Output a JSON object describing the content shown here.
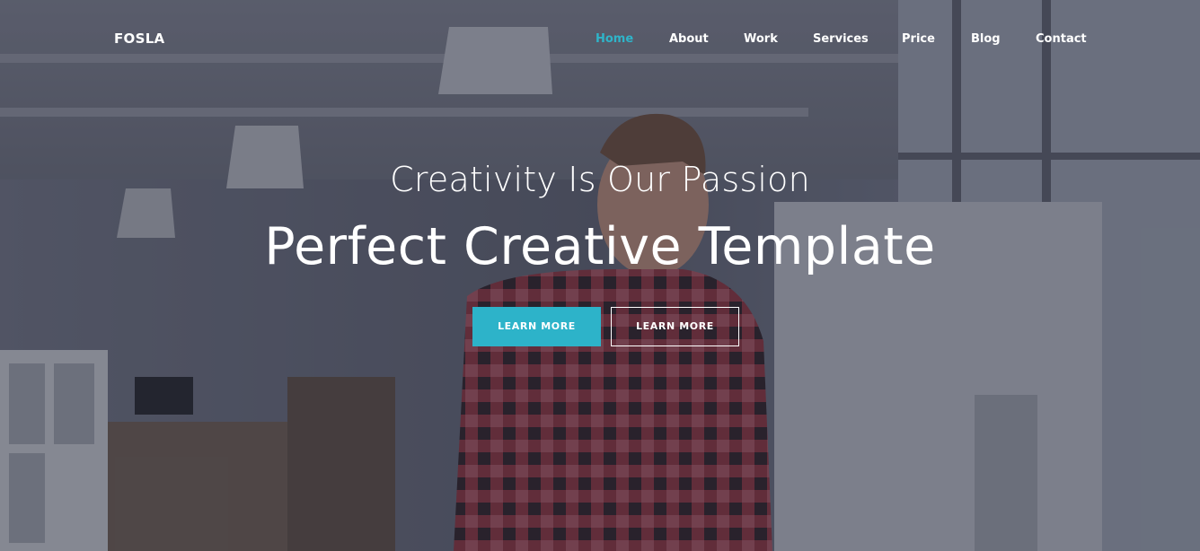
{
  "brand": "FOSLA",
  "nav": {
    "items": [
      {
        "label": "Home",
        "active": true
      },
      {
        "label": "About"
      },
      {
        "label": "Work"
      },
      {
        "label": "Services"
      },
      {
        "label": "Price"
      },
      {
        "label": "Blog"
      },
      {
        "label": "Contact"
      }
    ]
  },
  "hero": {
    "subtitle": "Creativity Is Our Passion",
    "title": "Perfect Creative Template",
    "primary_button": "LEARN MORE",
    "secondary_button": "LEARN MORE"
  },
  "colors": {
    "accent": "#2db3c9",
    "text": "#ffffff"
  }
}
